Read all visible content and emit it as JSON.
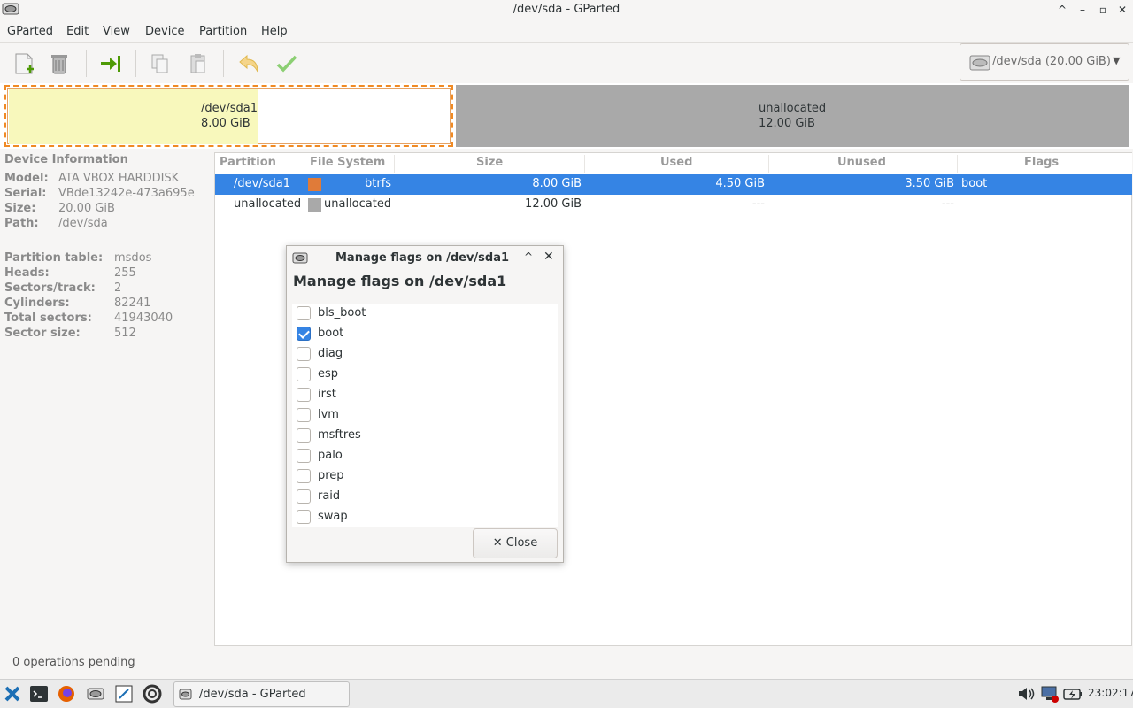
{
  "window": {
    "title": "/dev/sda - GParted"
  },
  "menubar": [
    "GParted",
    "Edit",
    "View",
    "Device",
    "Partition",
    "Help"
  ],
  "toolbar": {
    "device_selector": "/dev/sda (20.00 GiB)"
  },
  "disk_map": {
    "partitions": [
      {
        "name": "/dev/sda1",
        "size": "8.00 GiB",
        "used_fraction": 0.5625,
        "fs_color": "#f8f8bc",
        "border_color": "#f08a24"
      },
      {
        "name": "unallocated",
        "size": "12.00 GiB",
        "fs_color": "#a9a9a9"
      }
    ]
  },
  "device_info": {
    "header": "Device Information",
    "rows": [
      {
        "key": "Model:",
        "value": "ATA VBOX HARDDISK"
      },
      {
        "key": "Serial:",
        "value": "VBde13242e-473a695e"
      },
      {
        "key": "Size:",
        "value": "20.00 GiB"
      },
      {
        "key": "Path:",
        "value": "/dev/sda"
      },
      {
        "key": "Partition table:",
        "value": "msdos"
      },
      {
        "key": "Heads:",
        "value": "255"
      },
      {
        "key": "Sectors/track:",
        "value": "2"
      },
      {
        "key": "Cylinders:",
        "value": "82241"
      },
      {
        "key": "Total sectors:",
        "value": "41943040"
      },
      {
        "key": "Sector size:",
        "value": "512"
      }
    ]
  },
  "partition_table": {
    "columns": [
      "Partition",
      "File System",
      "Size",
      "Used",
      "Unused",
      "Flags"
    ],
    "rows": [
      {
        "partition": "/dev/sda1",
        "fs_color": "#e07b39",
        "file_system": "btrfs",
        "size": "8.00 GiB",
        "used": "4.50 GiB",
        "unused": "3.50 GiB",
        "flags": "boot",
        "selected": true
      },
      {
        "partition": "unallocated",
        "fs_color": "#a9a9a9",
        "file_system": "unallocated",
        "size": "12.00 GiB",
        "used": "---",
        "unused": "---",
        "flags": "",
        "selected": false
      }
    ]
  },
  "dialog": {
    "title": "Manage flags on /dev/sda1",
    "heading": "Manage flags on /dev/sda1",
    "flags": [
      {
        "name": "bls_boot",
        "checked": false
      },
      {
        "name": "boot",
        "checked": true
      },
      {
        "name": "diag",
        "checked": false
      },
      {
        "name": "esp",
        "checked": false
      },
      {
        "name": "irst",
        "checked": false
      },
      {
        "name": "lvm",
        "checked": false
      },
      {
        "name": "msftres",
        "checked": false
      },
      {
        "name": "palo",
        "checked": false
      },
      {
        "name": "prep",
        "checked": false
      },
      {
        "name": "raid",
        "checked": false
      },
      {
        "name": "swap",
        "checked": false
      }
    ],
    "close_label": "✕ Close"
  },
  "status": {
    "text": "0 operations pending"
  },
  "taskbar": {
    "window_button": "/dev/sda - GParted",
    "clock": "23:02:17"
  },
  "colors": {
    "accent": "#3584e4",
    "selection_text": "#ffffff"
  }
}
